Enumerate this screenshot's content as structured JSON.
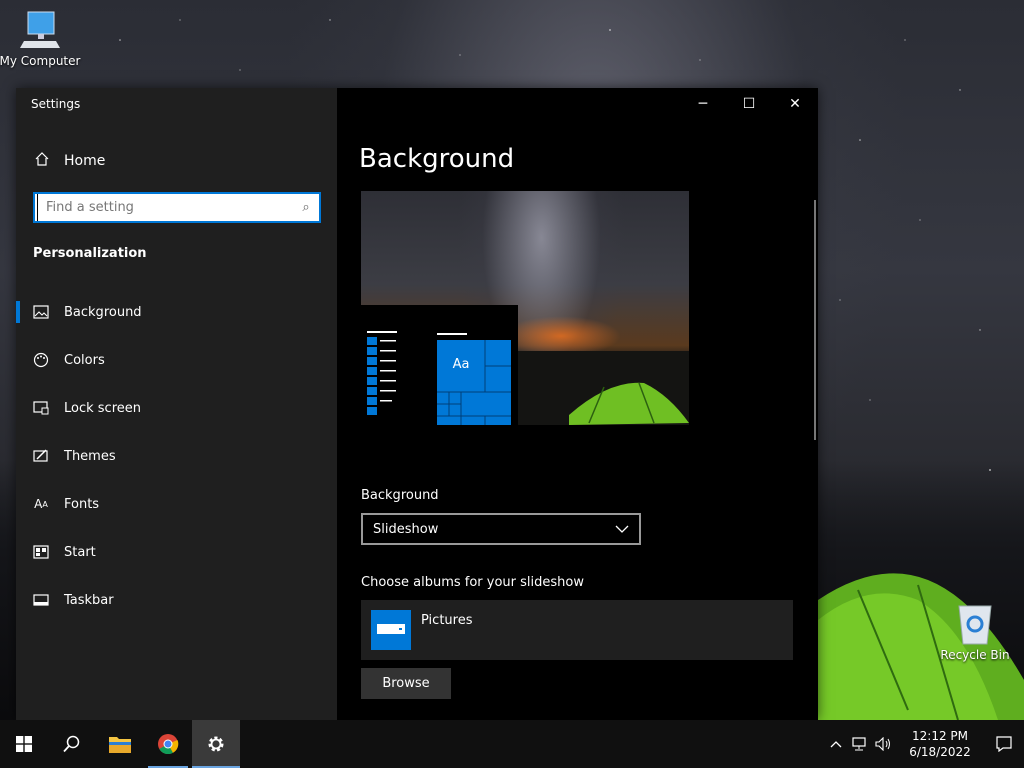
{
  "desktop": {
    "icons": [
      {
        "label": "My Computer",
        "icon": "computer-icon"
      },
      {
        "label": "Recycle Bin",
        "icon": "recycle-bin-icon"
      }
    ]
  },
  "window": {
    "title": "Settings",
    "controls": {
      "minimize": "─",
      "maximize": "☐",
      "close": "✕"
    }
  },
  "nav": {
    "home_label": "Home",
    "search": {
      "placeholder": "Find a setting",
      "value": ""
    },
    "section": "Personalization",
    "items": [
      {
        "label": "Background",
        "icon": "picture-icon",
        "active": true
      },
      {
        "label": "Colors",
        "icon": "palette-icon",
        "active": false
      },
      {
        "label": "Lock screen",
        "icon": "lock-screen-icon",
        "active": false
      },
      {
        "label": "Themes",
        "icon": "themes-icon",
        "active": false
      },
      {
        "label": "Fonts",
        "icon": "fonts-icon",
        "active": false
      },
      {
        "label": "Start",
        "icon": "start-icon",
        "active": false
      },
      {
        "label": "Taskbar",
        "icon": "taskbar-icon",
        "active": false
      }
    ]
  },
  "content": {
    "title": "Background",
    "preview_tile_text": "Aa",
    "background_label": "Background",
    "background_value": "Slideshow",
    "albums_label": "Choose albums for your slideshow",
    "album_name": "Pictures",
    "browse_label": "Browse"
  },
  "taskbar": {
    "apps": [
      "start-icon",
      "search-icon",
      "file-explorer-icon",
      "chrome-icon",
      "settings-icon"
    ],
    "time": "12:12 PM",
    "date": "6/18/2022"
  },
  "colors": {
    "accent": "#0078d7",
    "nav_bg": "#1f1f1f",
    "content_bg": "#000000"
  }
}
